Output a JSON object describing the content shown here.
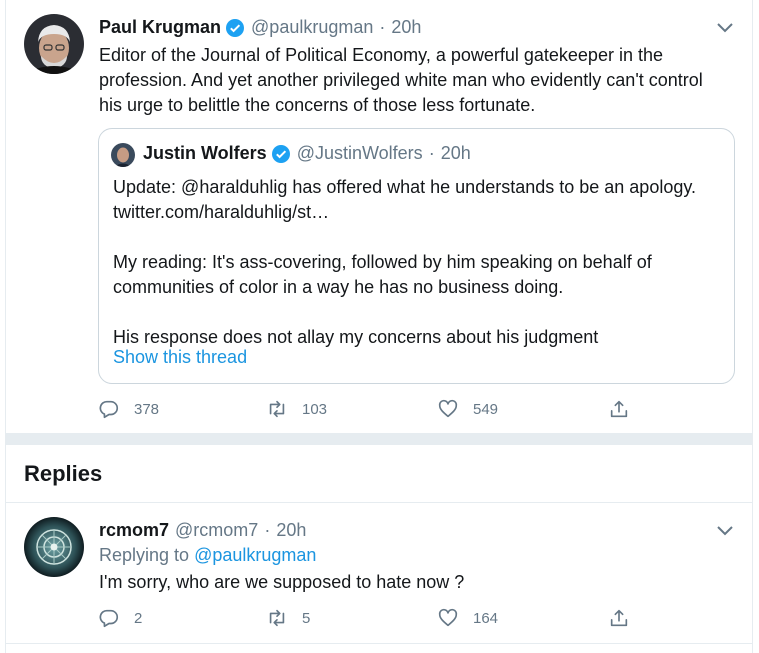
{
  "tweet": {
    "author_name": "Paul Krugman",
    "handle": "@paulkrugman",
    "separator": "·",
    "time": "20h",
    "text_lines": [
      "Editor of the Journal of Political Economy, a powerful gatekeeper in the",
      "profession. And yet another privileged white man who evidently can't control",
      "his urge to belittle the concerns of those less fortunate."
    ],
    "quoted": {
      "author_name": "Justin Wolfers",
      "handle": "@JustinWolfers",
      "separator": "·",
      "time": "20h",
      "text_lines": [
        "Update: @haralduhlig has offered what he understands to be an apology.",
        "twitter.com/haralduhlig/st…",
        "",
        "My reading: It's ass-covering, followed by him speaking on behalf of",
        "communities of color in a way he has no business doing.",
        "",
        "His response does not allay my concerns about his judgment"
      ],
      "show_thread": "Show this thread"
    },
    "actions": {
      "replies": "378",
      "retweets": "103",
      "likes": "549"
    }
  },
  "replies_heading": "Replies",
  "reply": {
    "author_name": "rcmom7",
    "handle": "@rcmom7",
    "separator": "·",
    "time": "20h",
    "replying_to_prefix": "Replying to",
    "replying_to_handle": "@paulkrugman",
    "text": "I'm sorry, who are we supposed to hate now ?",
    "actions": {
      "replies": "2",
      "retweets": "5",
      "likes": "164"
    }
  },
  "icons": {
    "reply": "reply-icon",
    "retweet": "retweet-icon",
    "like": "heart-icon",
    "share": "share-icon",
    "verified": "verified-badge-icon",
    "caret": "chevron-down-icon"
  },
  "colors": {
    "link": "#1b95e0",
    "muted": "#657786",
    "verified": "#1da1f2",
    "border": "#e6ecf0"
  }
}
